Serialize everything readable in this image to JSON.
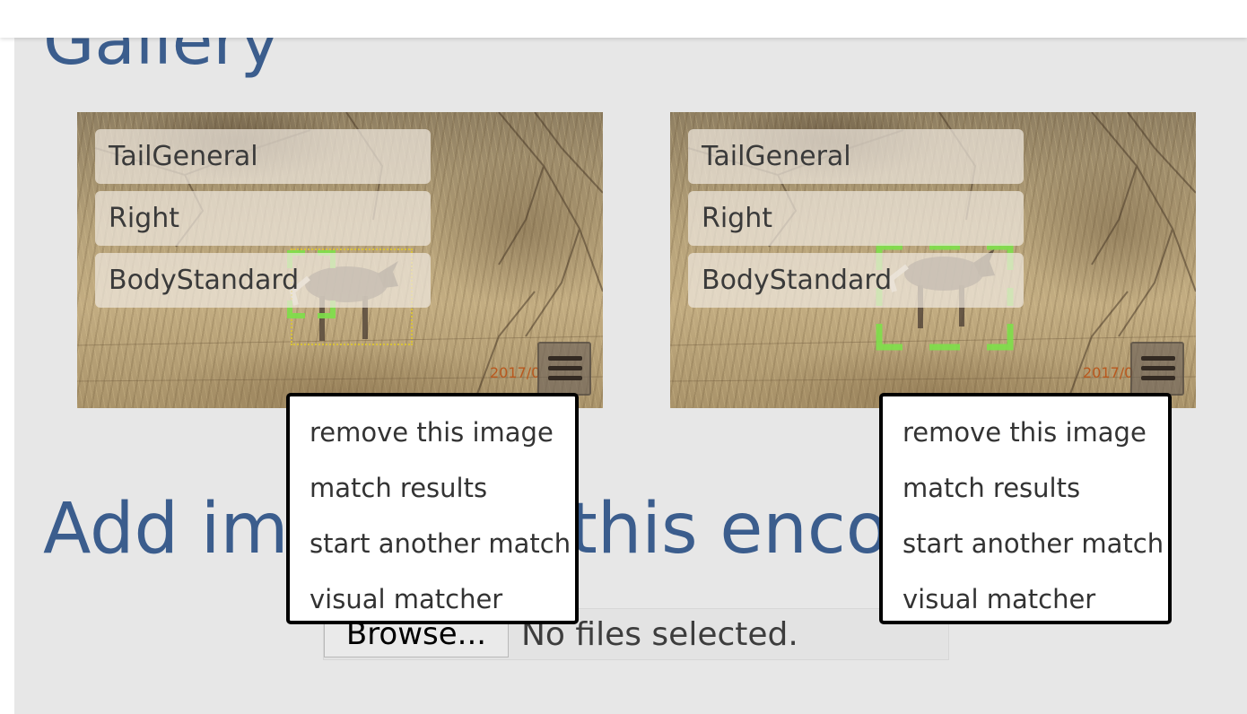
{
  "gallery": {
    "title": "Gallery",
    "images": [
      {
        "labels": [
          "TailGeneral",
          "Right",
          "BodyStandard"
        ],
        "date_stamp": "2017/0",
        "menu_icon": "hamburger-icon",
        "menu": [
          "remove this image",
          "match results",
          "start another match",
          "visual matcher"
        ]
      },
      {
        "labels": [
          "TailGeneral",
          "Right",
          "BodyStandard"
        ],
        "date_stamp": "2017/0",
        "menu_icon": "hamburger-icon",
        "menu": [
          "remove this image",
          "match results",
          "start another match",
          "visual matcher"
        ]
      }
    ]
  },
  "add_images": {
    "title": "Add images to this encounter",
    "browse_label": "Browse...",
    "file_status": "No files selected."
  },
  "colors": {
    "heading": "#3b5d8d",
    "panel_bg": "#e7e7e7",
    "bbox_green": "#7ee04a",
    "bbox_yellow": "#d9c23a"
  }
}
